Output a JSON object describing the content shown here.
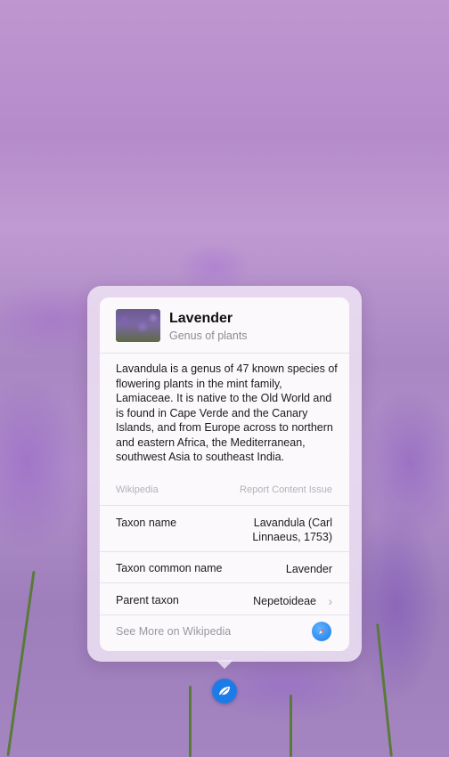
{
  "lookup": {
    "title": "Lavender",
    "subtitle": "Genus of plants",
    "description": "Lavandula is a genus of 47 known species of flowering plants in the mint family, Lamiaceae. It is native to the Old World and is found in Cape Verde and the Canary Islands, and from Europe across to northern and eastern Africa, the Mediterranean, southwest Asia to southeast India.",
    "source_label": "Wikipedia",
    "report_label": "Report Content Issue",
    "rows": [
      {
        "label": "Taxon name",
        "value_line1": "Lavandula (Carl",
        "value_line2": "Linnaeus, 1753)"
      },
      {
        "label": "Taxon common name",
        "value": "Lavender"
      },
      {
        "label": "Parent taxon",
        "value": "Nepetoideae"
      }
    ],
    "see_more_label": "See More on Wikipedia"
  },
  "icons": {
    "chevron": "chevron-right-icon",
    "safari": "safari-compass-icon",
    "lookup": "visual-lookup-leaf-icon"
  },
  "colors": {
    "accent": "#1d7be8",
    "panel": "#f2e8f6",
    "secondary_text": "#8f8a93"
  }
}
